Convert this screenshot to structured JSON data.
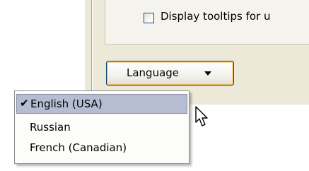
{
  "options_panel": {
    "tooltip_checkbox": {
      "label": "Display tooltips for u",
      "checked": false
    }
  },
  "language_button": {
    "label": "Language",
    "icon": "chevron-down-icon"
  },
  "language_menu": {
    "items": [
      {
        "label": "English (USA)",
        "checked": true,
        "check_glyph": "✔"
      },
      {
        "label": "Russian",
        "checked": false
      },
      {
        "label": "French (Canadian)",
        "checked": false
      }
    ]
  },
  "colors": {
    "window_bg": "#ece9d8",
    "selection": "#b6bdd2",
    "button_border": "#003c74",
    "focus_ring": "#f6c066"
  }
}
